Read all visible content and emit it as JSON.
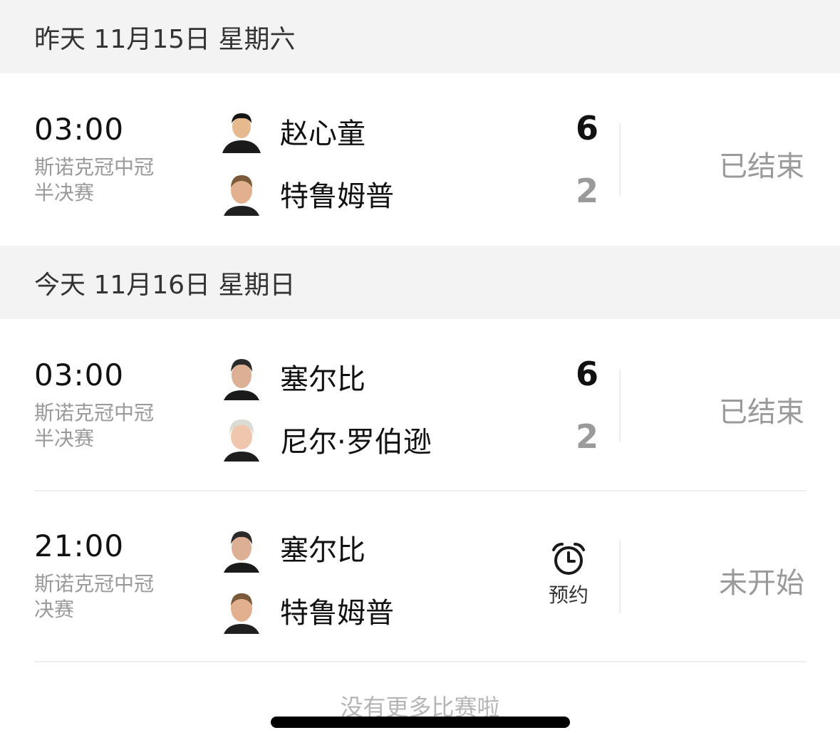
{
  "days": [
    {
      "header": "昨天 11月15日 星期六"
    },
    {
      "header": "今天 11月16日 星期日"
    }
  ],
  "matches": [
    {
      "time": "03:00",
      "league": "斯诺克冠中冠",
      "round": "半决赛",
      "player1": {
        "name": "赵心童",
        "score": "6",
        "avatar": "player-zhao-avatar"
      },
      "player2": {
        "name": "特鲁姆普",
        "score": "2",
        "avatar": "player-trump-avatar"
      },
      "status": "已结束"
    },
    {
      "time": "03:00",
      "league": "斯诺克冠中冠",
      "round": "半决赛",
      "player1": {
        "name": "塞尔比",
        "score": "6",
        "avatar": "player-selby-avatar"
      },
      "player2": {
        "name": "尼尔·罗伯逊",
        "score": "2",
        "avatar": "player-robertson-avatar"
      },
      "status": "已结束"
    },
    {
      "time": "21:00",
      "league": "斯诺克冠中冠",
      "round": "决赛",
      "player1": {
        "name": "塞尔比",
        "avatar": "player-selby-avatar"
      },
      "player2": {
        "name": "特鲁姆普",
        "avatar": "player-trump-avatar"
      },
      "reserve": {
        "label": "预约",
        "icon": "alarm-clock-icon"
      },
      "status": "未开始"
    }
  ],
  "footer": {
    "text": "没有更多比赛啦"
  },
  "colors": {
    "header_bg": "#f3f3f4",
    "muted": "#9a9a9a",
    "primary_text": "#111111"
  }
}
